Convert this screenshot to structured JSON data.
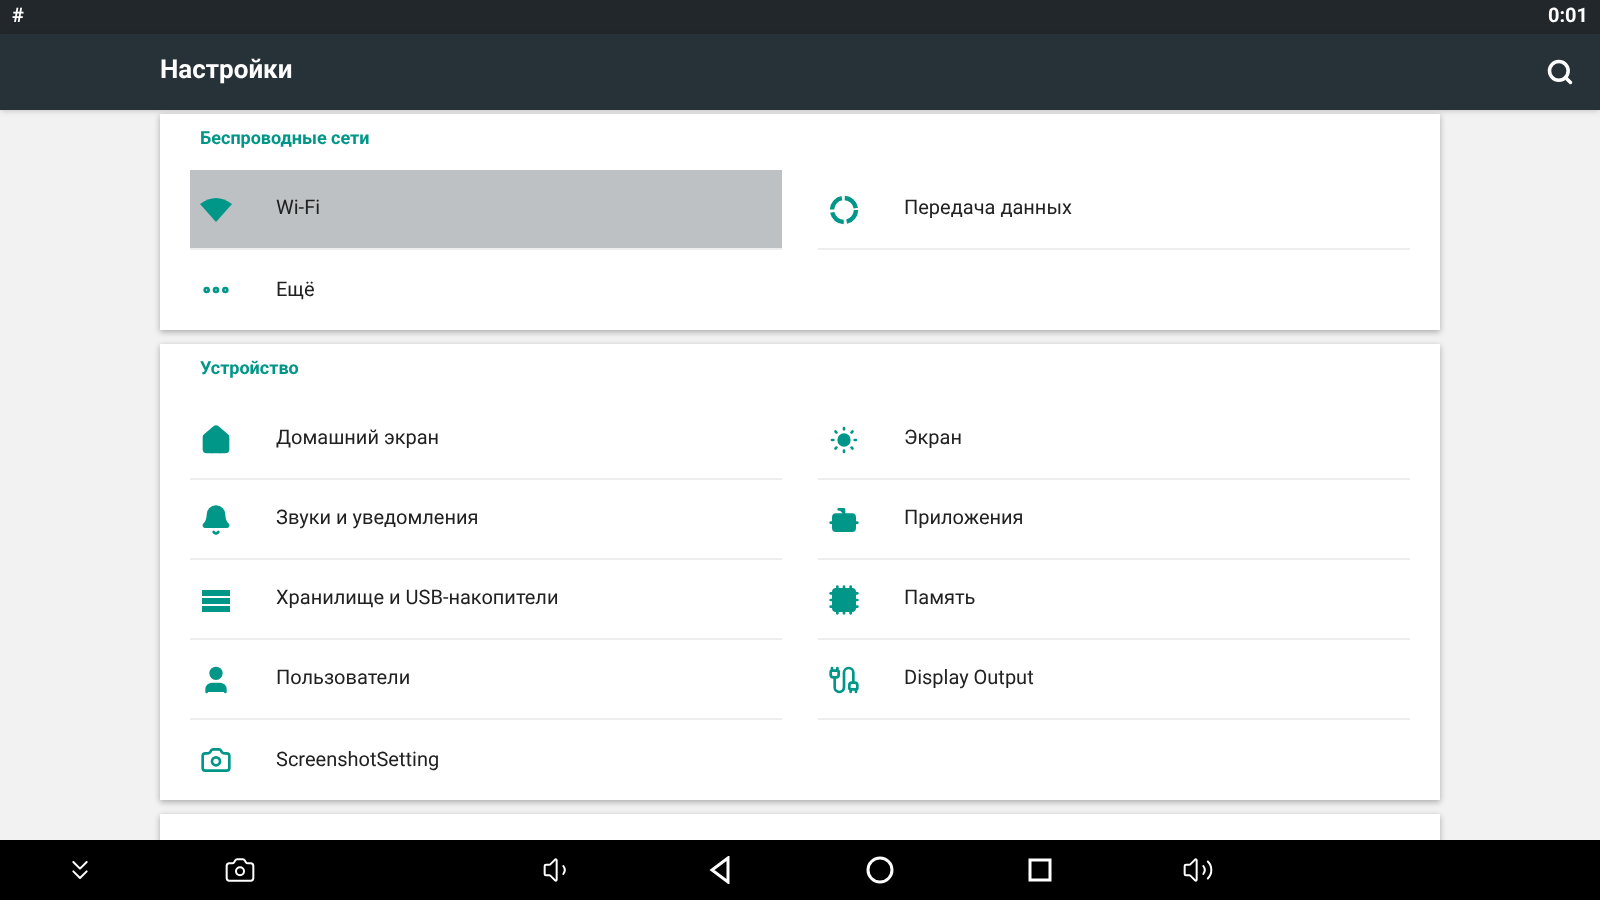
{
  "status_bar": {
    "left": "#",
    "time": "0:01"
  },
  "toolbar": {
    "title": "Настройки"
  },
  "sections": [
    {
      "title": "Беспроводные сети",
      "items": [
        {
          "label": "Wi-Fi",
          "kind": "wifi",
          "selected": true
        },
        {
          "label": "Передача данных",
          "kind": "data",
          "selected": false
        },
        {
          "label": "Ещё",
          "kind": "more",
          "selected": false
        }
      ]
    },
    {
      "title": "Устройство",
      "items": [
        {
          "label": "Домашний экран",
          "kind": "home",
          "selected": false
        },
        {
          "label": "Экран",
          "kind": "display",
          "selected": false
        },
        {
          "label": "Звуки и уведомления",
          "kind": "bell",
          "selected": false
        },
        {
          "label": "Приложения",
          "kind": "apps",
          "selected": false
        },
        {
          "label": "Хранилище и USB-накопители",
          "kind": "storage",
          "selected": false
        },
        {
          "label": "Память",
          "kind": "memory",
          "selected": false
        },
        {
          "label": "Пользователи",
          "kind": "user",
          "selected": false
        },
        {
          "label": "Display Output",
          "kind": "output",
          "selected": false
        },
        {
          "label": "ScreenshotSetting",
          "kind": "screenshot",
          "selected": false
        }
      ]
    }
  ]
}
